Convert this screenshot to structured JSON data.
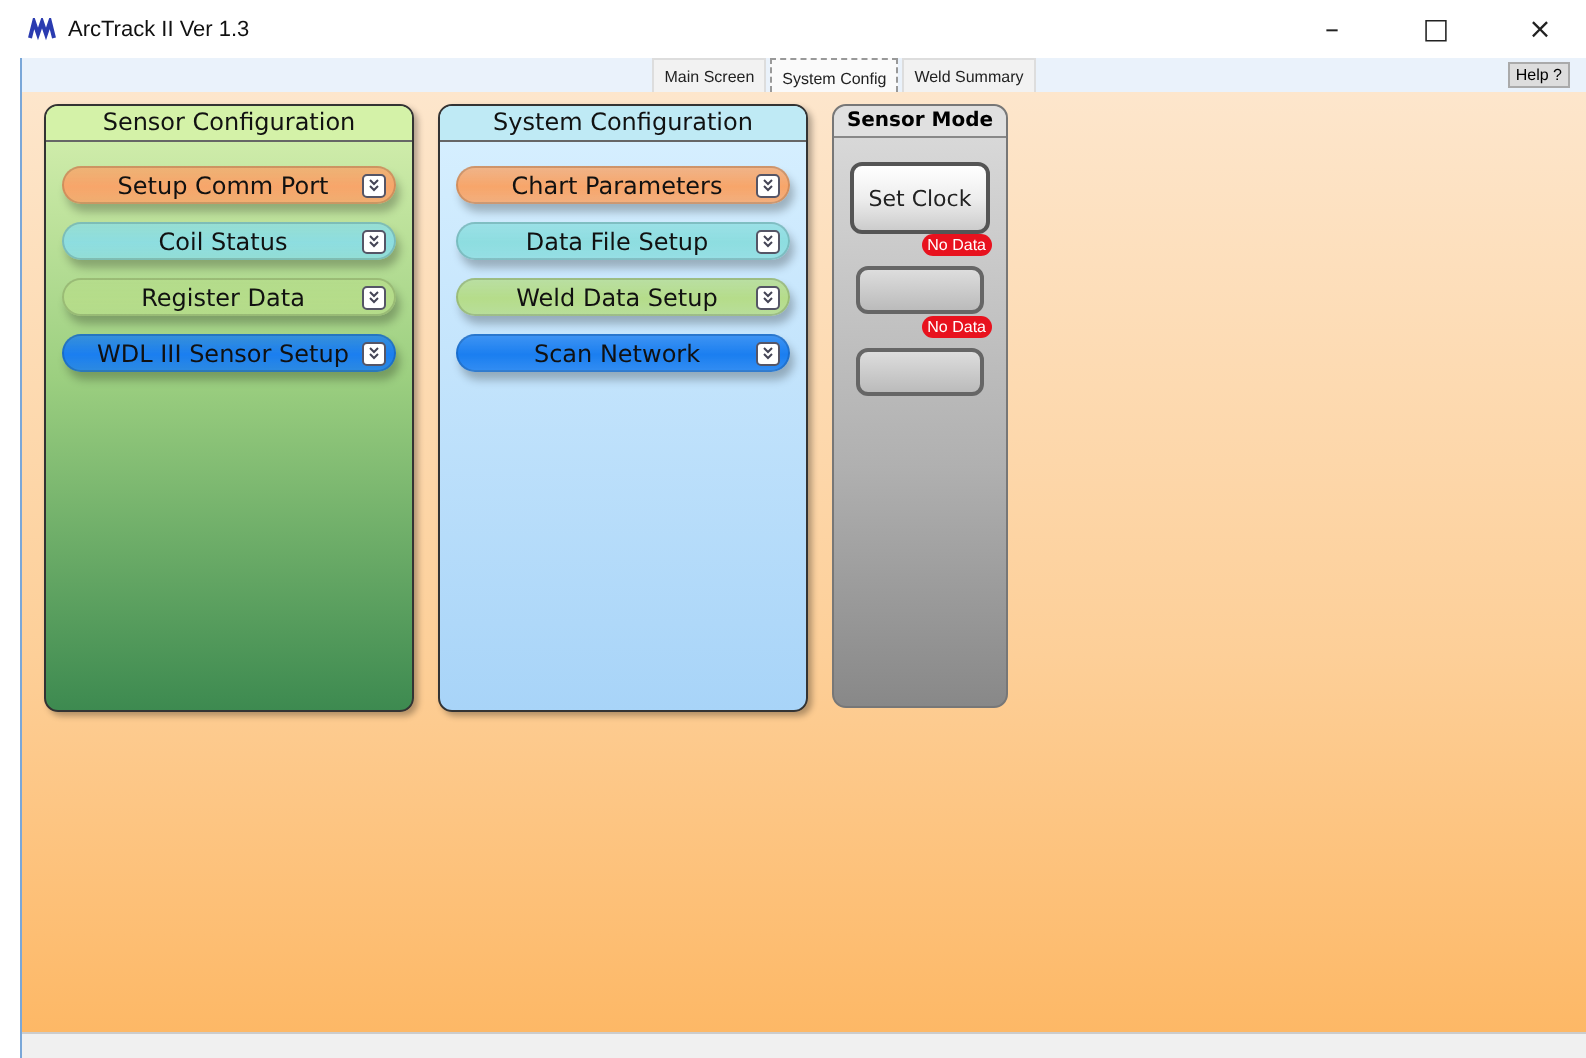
{
  "window": {
    "title": "ArcTrack II Ver 1.3",
    "controls": [
      "–",
      "□",
      "×"
    ]
  },
  "tabs": [
    {
      "label": "Main Screen",
      "selected": false
    },
    {
      "label": "System Config",
      "selected": true
    },
    {
      "label": "Weld Summary",
      "selected": false
    }
  ],
  "help_button": "Help ?",
  "panels": [
    {
      "title": "Sensor Configuration",
      "kind": "green",
      "buttons": [
        {
          "label": "Setup Comm Port",
          "color": "#f7a56a"
        },
        {
          "label": "Coil Status",
          "color": "#8ddde0"
        },
        {
          "label": "Register Data",
          "color": "#b5dc8a"
        },
        {
          "label": "WDL III Sensor Setup",
          "color": "#1a7ef0"
        }
      ]
    },
    {
      "title": "System Configuration",
      "kind": "blue",
      "buttons": [
        {
          "label": "Chart Parameters",
          "color": "#f7a56a"
        },
        {
          "label": "Data File Setup",
          "color": "#8ddde0"
        },
        {
          "label": "Weld Data Setup",
          "color": "#b5dc8a"
        },
        {
          "label": "Scan Network",
          "color": "#1a7ef0"
        }
      ]
    }
  ],
  "sensor_mode": {
    "title": "Sensor Mode",
    "buttons": [
      {
        "label": "Set Clock",
        "disabled": false
      },
      {
        "badge": "No Data",
        "disabled": true
      },
      {
        "badge": "No Data",
        "disabled": true
      }
    ]
  }
}
